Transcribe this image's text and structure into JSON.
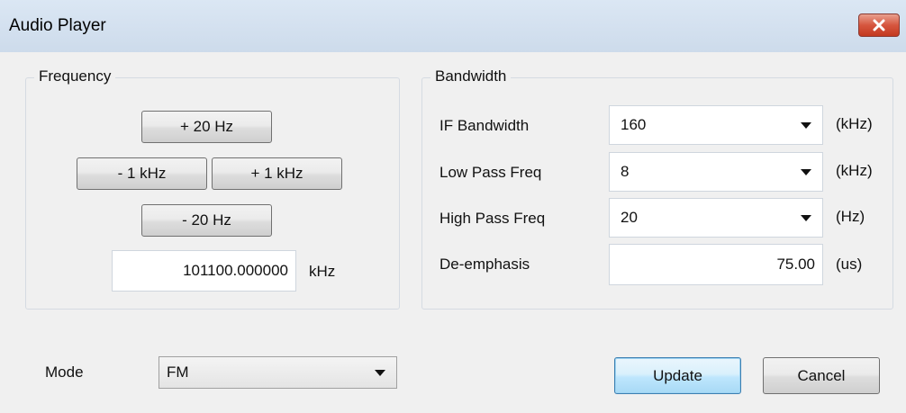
{
  "window": {
    "title": "Audio Player"
  },
  "frequency": {
    "group_label": "Frequency",
    "plus_20hz_label": "+ 20 Hz",
    "minus_1khz_label": "- 1 kHz",
    "plus_1khz_label": "+ 1 kHz",
    "minus_20hz_label": "- 20 Hz",
    "value": "101100.000000",
    "unit": "kHz"
  },
  "bandwidth": {
    "group_label": "Bandwidth",
    "if_bandwidth": {
      "label": "IF Bandwidth",
      "value": "160",
      "unit": "(kHz)"
    },
    "low_pass": {
      "label": "Low Pass Freq",
      "value": "8",
      "unit": "(kHz)"
    },
    "high_pass": {
      "label": "High Pass Freq",
      "value": "20",
      "unit": "(Hz)"
    },
    "de_emphasis": {
      "label": "De-emphasis",
      "value": "75.00",
      "unit": "(us)"
    }
  },
  "mode": {
    "label": "Mode",
    "value": "FM"
  },
  "actions": {
    "update_label": "Update",
    "cancel_label": "Cancel"
  },
  "icons": {
    "close": "close-icon",
    "dropdown": "chevron-down-icon"
  },
  "colors": {
    "close_button": "#c3391f",
    "default_button_border": "#3c7fb1"
  }
}
